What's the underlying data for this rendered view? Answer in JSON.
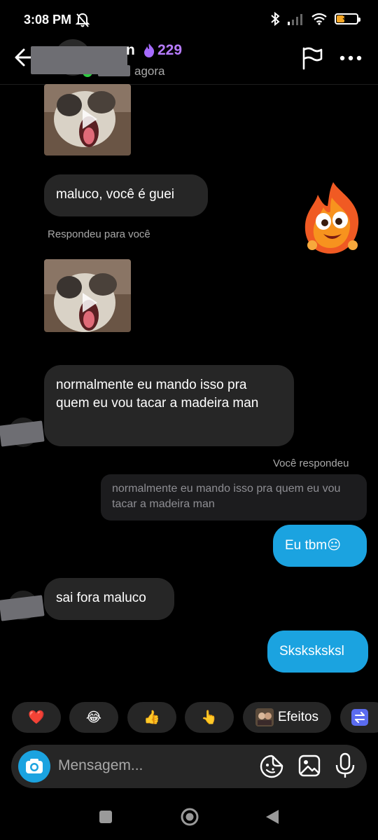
{
  "status_bar": {
    "time": "3:08 PM",
    "battery_level": "39",
    "icons": [
      "bell-off-icon",
      "bluetooth-icon",
      "signal-icon",
      "wifi-icon",
      "battery-icon"
    ]
  },
  "header": {
    "name_visible": "n",
    "streak_count": "229",
    "status": "agora",
    "icons": [
      "back-arrow-icon",
      "flag-icon",
      "more-icon"
    ]
  },
  "messages": {
    "text_1": "maluco, você é guei",
    "reply_meta_1": "Respondeu para você",
    "text_2": "normalmente eu mando isso pra quem eu vou tacar a madeira man",
    "reply_meta_2": "Você respondeu",
    "quoted_2": "normalmente eu mando isso pra quem eu vou tacar a madeira man",
    "sent_1": "Eu tbm😐",
    "text_3": "sai fora maluco",
    "sent_2": "Sksksksksl"
  },
  "quick_reactions": {
    "items": [
      "❤️",
      "😂",
      "👍",
      "👆"
    ],
    "effects_label": "Efeitos"
  },
  "composer": {
    "placeholder": "Mensagem..."
  },
  "colors": {
    "background": "#000000",
    "incoming_bubble": "#262626",
    "outgoing_bubble": "#1ba3e0",
    "streak": "#b77cff"
  }
}
